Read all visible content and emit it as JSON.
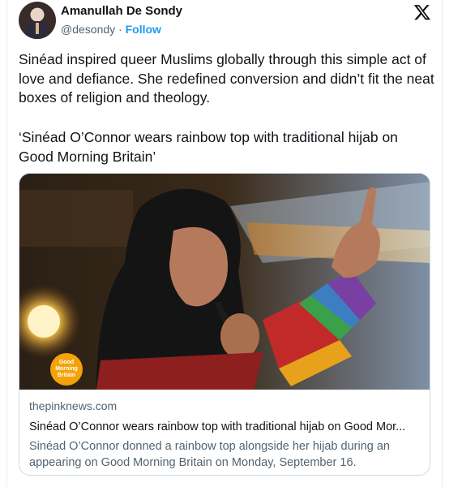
{
  "author": {
    "name": "Amanullah De Sondy",
    "handle": "@desondy",
    "separator": "·",
    "follow_label": "Follow"
  },
  "tweet": {
    "text": "Sinéad inspired queer Muslims globally through this simple act of love and defiance. She redefined conversion and didn’t fit the neat boxes of religion and theology.",
    "quote": "‘Sinéad O’Connor wears rainbow top with traditional hijab on Good Morning Britain’"
  },
  "link_card": {
    "domain": "thepinknews.com",
    "title": "Sinéad O’Connor wears rainbow top with traditional hijab on Good Mor...",
    "description": "Sinéad O’Connor donned a rainbow top alongside her hijab during an appearing on Good Morning Britain on Monday, September 16.",
    "badge_lines": [
      "Good",
      "Morning",
      "Britain"
    ]
  },
  "icons": {
    "logo": "x-logo-icon",
    "avatar": "avatar-image"
  },
  "colors": {
    "link_blue": "#1d9bf0",
    "text": "#0f1419",
    "muted": "#536471",
    "border": "#cfd9de"
  }
}
